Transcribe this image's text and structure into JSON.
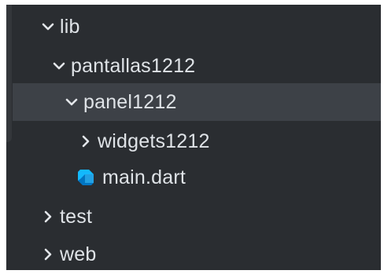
{
  "explorer": {
    "items": [
      {
        "label": "lib",
        "expanded": true,
        "icon": "chevron-down-icon"
      },
      {
        "label": "pantallas1212",
        "expanded": true,
        "icon": "chevron-down-icon"
      },
      {
        "label": "panel1212",
        "expanded": true,
        "icon": "chevron-down-icon",
        "selected": true
      },
      {
        "label": "widgets1212",
        "expanded": false,
        "icon": "chevron-right-icon"
      },
      {
        "label": "main.dart",
        "icon": "dart-file-icon"
      },
      {
        "label": "test",
        "expanded": false,
        "icon": "chevron-right-icon"
      },
      {
        "label": "web",
        "expanded": false,
        "icon": "chevron-right-icon"
      }
    ]
  },
  "colors": {
    "background": "#2a2d31",
    "selected_row": "#3d4147",
    "text": "#dfe3e7",
    "dart_blue_dark": "#0175c2",
    "dart_blue_light": "#13b9fd"
  }
}
